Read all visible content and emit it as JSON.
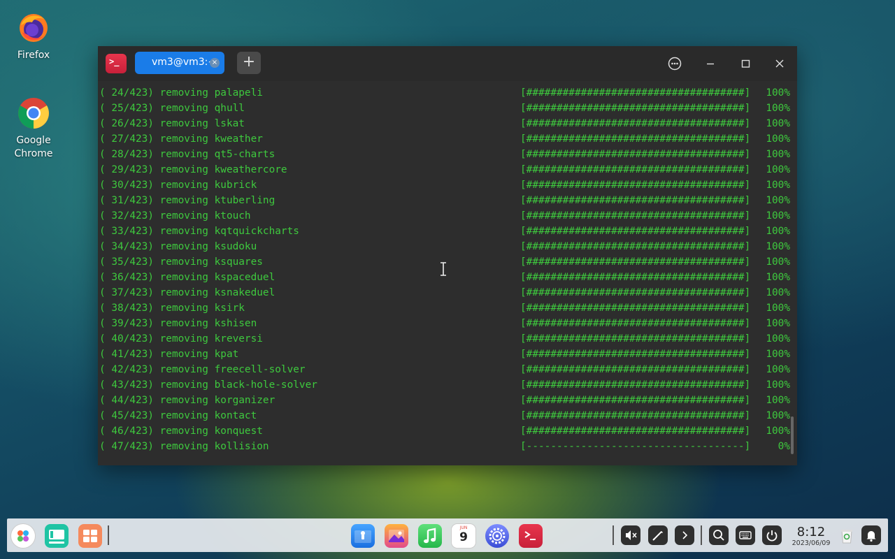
{
  "desktop": {
    "icons": [
      {
        "label": "Firefox",
        "icon": "firefox-icon"
      },
      {
        "label": "Google\nChrome",
        "icon": "chrome-icon"
      }
    ]
  },
  "terminal": {
    "tab_title": "vm3@vm3:~",
    "tab_close": "×",
    "new_tab": "+",
    "app_icon_glyph": ">_",
    "lines": [
      {
        "index": "( 24/423) removing palapeli",
        "bar": "[####################################]",
        "pct": "100%"
      },
      {
        "index": "( 25/423) removing qhull",
        "bar": "[####################################]",
        "pct": "100%"
      },
      {
        "index": "( 26/423) removing lskat",
        "bar": "[####################################]",
        "pct": "100%"
      },
      {
        "index": "( 27/423) removing kweather",
        "bar": "[####################################]",
        "pct": "100%"
      },
      {
        "index": "( 28/423) removing qt5-charts",
        "bar": "[####################################]",
        "pct": "100%"
      },
      {
        "index": "( 29/423) removing kweathercore",
        "bar": "[####################################]",
        "pct": "100%"
      },
      {
        "index": "( 30/423) removing kubrick",
        "bar": "[####################################]",
        "pct": "100%"
      },
      {
        "index": "( 31/423) removing ktuberling",
        "bar": "[####################################]",
        "pct": "100%"
      },
      {
        "index": "( 32/423) removing ktouch",
        "bar": "[####################################]",
        "pct": "100%"
      },
      {
        "index": "( 33/423) removing kqtquickcharts",
        "bar": "[####################################]",
        "pct": "100%"
      },
      {
        "index": "( 34/423) removing ksudoku",
        "bar": "[####################################]",
        "pct": "100%"
      },
      {
        "index": "( 35/423) removing ksquares",
        "bar": "[####################################]",
        "pct": "100%"
      },
      {
        "index": "( 36/423) removing kspaceduel",
        "bar": "[####################################]",
        "pct": "100%"
      },
      {
        "index": "( 37/423) removing ksnakeduel",
        "bar": "[####################################]",
        "pct": "100%"
      },
      {
        "index": "( 38/423) removing ksirk",
        "bar": "[####################################]",
        "pct": "100%"
      },
      {
        "index": "( 39/423) removing kshisen",
        "bar": "[####################################]",
        "pct": "100%"
      },
      {
        "index": "( 40/423) removing kreversi",
        "bar": "[####################################]",
        "pct": "100%"
      },
      {
        "index": "( 41/423) removing kpat",
        "bar": "[####################################]",
        "pct": "100%"
      },
      {
        "index": "( 42/423) removing freecell-solver",
        "bar": "[####################################]",
        "pct": "100%"
      },
      {
        "index": "( 43/423) removing black-hole-solver",
        "bar": "[####################################]",
        "pct": "100%"
      },
      {
        "index": "( 44/423) removing korganizer",
        "bar": "[####################################]",
        "pct": "100%"
      },
      {
        "index": "( 45/423) removing kontact",
        "bar": "[####################################]",
        "pct": "100%"
      },
      {
        "index": "( 46/423) removing konquest",
        "bar": "[####################################]",
        "pct": "100%"
      },
      {
        "index": "( 47/423) removing kollision",
        "bar": "[------------------------------------]",
        "pct": "0%"
      }
    ],
    "text_color": "#3ec93e"
  },
  "taskbar": {
    "calendar_day": "9",
    "calendar_month": "JUN",
    "clock_time": "8:12",
    "clock_date": "2023/06/09"
  }
}
